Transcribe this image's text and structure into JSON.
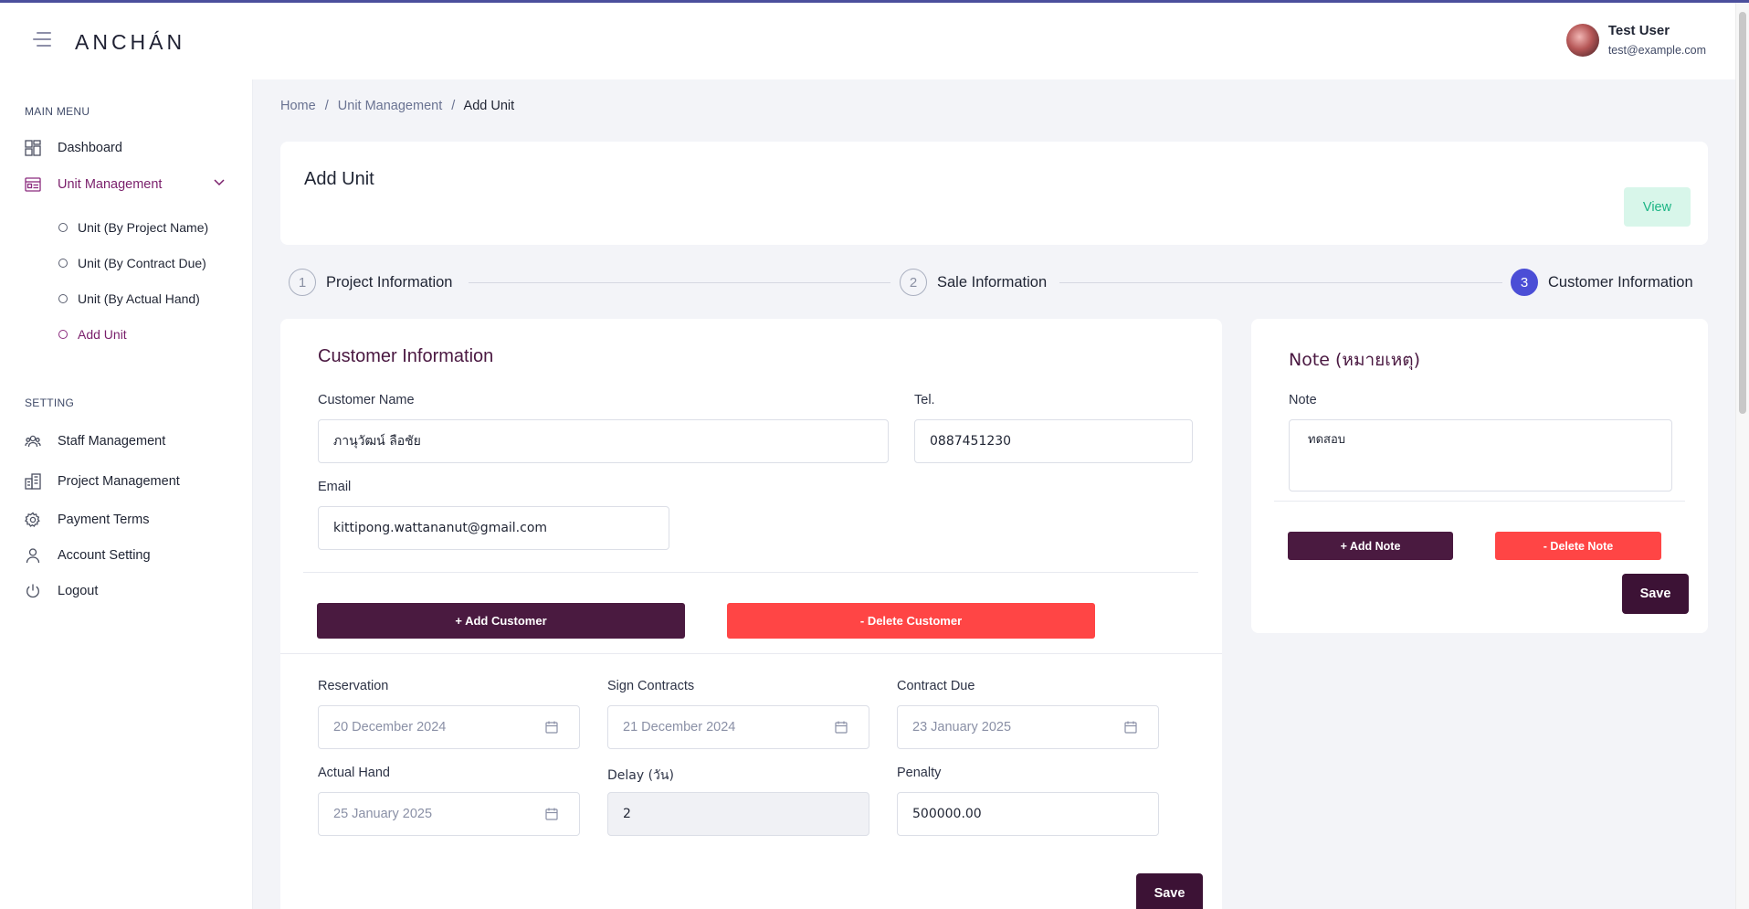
{
  "app": {
    "logo": "ANCHÁN"
  },
  "user": {
    "name": "Test User",
    "email": "test@example.com"
  },
  "sidebar": {
    "main_menu_heading": "MAIN MENU",
    "dashboard": "Dashboard",
    "unit_management": "Unit Management",
    "sub_items": [
      "Unit (By Project Name)",
      "Unit (By Contract Due)",
      "Unit (By Actual Hand)",
      "Add Unit"
    ],
    "setting_heading": "SETTING",
    "settings": [
      "Staff Management",
      "Project Management",
      "Payment Terms",
      "Account Setting",
      "Logout"
    ]
  },
  "breadcrumb": {
    "home": "Home",
    "sep": "/",
    "section": "Unit Management",
    "current": "Add Unit"
  },
  "page": {
    "title": "Add Unit",
    "view_label": "View"
  },
  "stepper": [
    {
      "num": "1",
      "label": "Project Information"
    },
    {
      "num": "2",
      "label": "Sale Information"
    },
    {
      "num": "3",
      "label": "Customer Information"
    }
  ],
  "customer": {
    "title": "Customer Information",
    "name_label": "Customer Name",
    "name_value": "ภานุวัฒน์ ลือชัย",
    "tel_label": "Tel.",
    "tel_value": "0887451230",
    "email_label": "Email",
    "email_value": "kittipong.wattananut@gmail.com",
    "add_label": "+ Add Customer",
    "delete_label": "- Delete Customer"
  },
  "dates": {
    "reservation_label": "Reservation",
    "reservation_value": "20 December 2024",
    "sign_label": "Sign Contracts",
    "sign_value": "21 December 2024",
    "due_label": "Contract Due",
    "due_value": "23 January 2025",
    "hand_label": "Actual Hand",
    "hand_value": "25 January 2025",
    "delay_label": "Delay (วัน)",
    "delay_value": "2",
    "penalty_label": "Penalty",
    "penalty_value": "500000.00",
    "save_label": "Save"
  },
  "note": {
    "title": "Note (หมายเหตุ)",
    "label": "Note",
    "value": "ทดสอบ",
    "add_label": "+ Add Note",
    "delete_label": "- Delete Note",
    "save_label": "Save"
  },
  "colors": {
    "accent": "#4a1a40",
    "danger": "#ff4545",
    "step_active": "#4b4ed6",
    "active_menu": "#7a1f6b"
  }
}
